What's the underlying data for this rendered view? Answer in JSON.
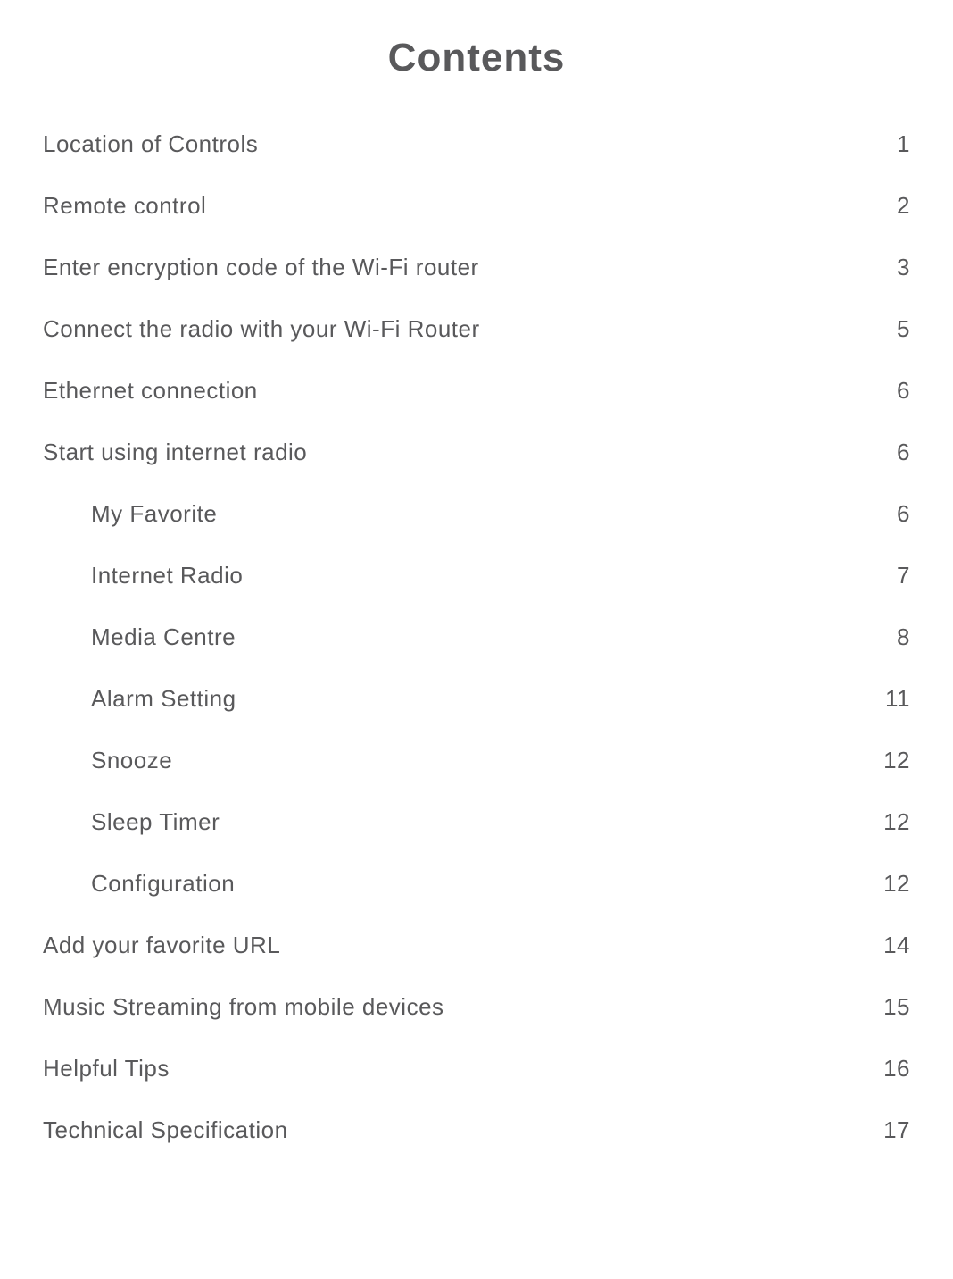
{
  "title": "Contents",
  "entries": [
    {
      "label": "Location of Controls",
      "page": "1",
      "sub": false
    },
    {
      "label": "Remote control",
      "page": "2",
      "sub": false
    },
    {
      "label": "Enter encryption code of the Wi-Fi router",
      "page": "3",
      "sub": false
    },
    {
      "label": "Connect the radio with your Wi-Fi Router",
      "page": "5",
      "sub": false
    },
    {
      "label": "Ethernet connection",
      "page": "6",
      "sub": false
    },
    {
      "label": "Start using internet radio",
      "page": "6",
      "sub": false
    },
    {
      "label": "My Favorite",
      "page": "6",
      "sub": true
    },
    {
      "label": "Internet Radio",
      "page": "7",
      "sub": true
    },
    {
      "label": "Media Centre",
      "page": "8",
      "sub": true
    },
    {
      "label": "Alarm Setting",
      "page": "11",
      "sub": true
    },
    {
      "label": "Snooze",
      "page": "12",
      "sub": true
    },
    {
      "label": "Sleep Timer",
      "page": "12",
      "sub": true
    },
    {
      "label": "Configuration",
      "page": "12",
      "sub": true
    },
    {
      "label": "Add your favorite URL",
      "page": "14",
      "sub": false
    },
    {
      "label": "Music Streaming from mobile devices",
      "page": "15",
      "sub": false
    },
    {
      "label": "Helpful Tips",
      "page": "16",
      "sub": false
    },
    {
      "label": "Technical Specification",
      "page": "17",
      "sub": false
    }
  ]
}
